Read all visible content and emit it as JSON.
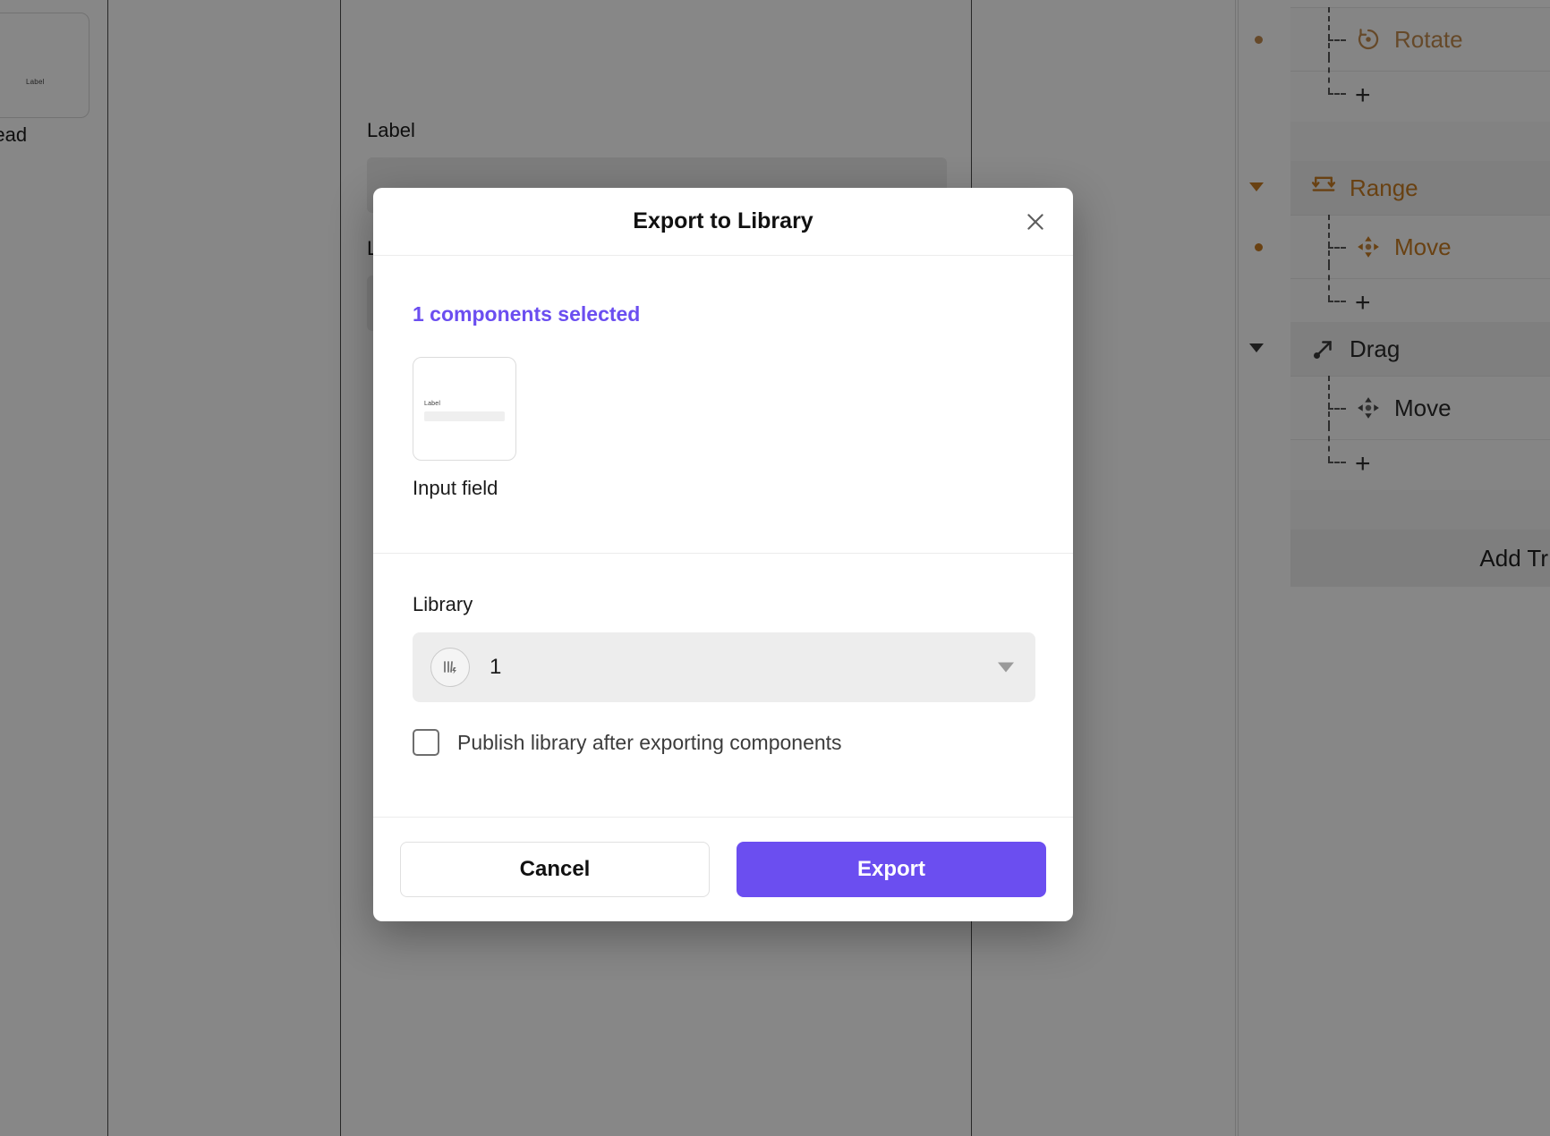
{
  "canvas": {
    "left_card": {
      "mini_label": "Label",
      "caption": "bel Head"
    },
    "fields": [
      {
        "label": "Label"
      },
      {
        "label": "L"
      }
    ]
  },
  "sidebar": {
    "rows": [
      {
        "label": "Rotate",
        "icon": "rotate-icon",
        "type": "child",
        "tone": "amber-soft",
        "marker": "dot"
      },
      {
        "label": "+",
        "icon": "plus-icon",
        "type": "plus",
        "tone": "dark",
        "marker": "none"
      },
      {
        "label": "",
        "icon": "",
        "type": "blank",
        "tone": "dark",
        "marker": "none"
      },
      {
        "label": "Range",
        "icon": "range-icon",
        "type": "group",
        "tone": "amber",
        "marker": "caret-amber"
      },
      {
        "label": "Move",
        "icon": "move-icon",
        "type": "child",
        "tone": "amber",
        "marker": "dot-strong"
      },
      {
        "label": "+",
        "icon": "plus-icon",
        "type": "plus",
        "tone": "dark",
        "marker": "none"
      },
      {
        "label": "",
        "icon": "",
        "type": "blank",
        "tone": "dark",
        "marker": "none"
      },
      {
        "label": "Drag",
        "icon": "drag-arrow-icon",
        "type": "group",
        "tone": "dark",
        "marker": "caret-dark"
      },
      {
        "label": "Move",
        "icon": "move-icon",
        "type": "child",
        "tone": "dark",
        "marker": "none"
      },
      {
        "label": "+",
        "icon": "plus-icon",
        "type": "plus",
        "tone": "dark",
        "marker": "none"
      },
      {
        "label": "",
        "icon": "",
        "type": "blank",
        "tone": "dark",
        "marker": "none"
      }
    ],
    "add_track_label": "Add Tr"
  },
  "modal": {
    "title": "Export to Library",
    "close_icon": "close-icon",
    "selected_count_text": "1 components selected",
    "component": {
      "caption": "Input field",
      "thumb_mini_label": "Label"
    },
    "library": {
      "field_label": "Library",
      "selected_name": "1",
      "icon": "library-bars-bolt-icon",
      "caret_icon": "chevron-down-icon"
    },
    "publish_checkbox": {
      "label": "Publish library after exporting components",
      "checked": false
    },
    "cancel_label": "Cancel",
    "export_label": "Export"
  },
  "colors": {
    "accent_purple": "#6B4EF0",
    "amber": "#C77C22",
    "amber_soft": "#C08A4E"
  }
}
